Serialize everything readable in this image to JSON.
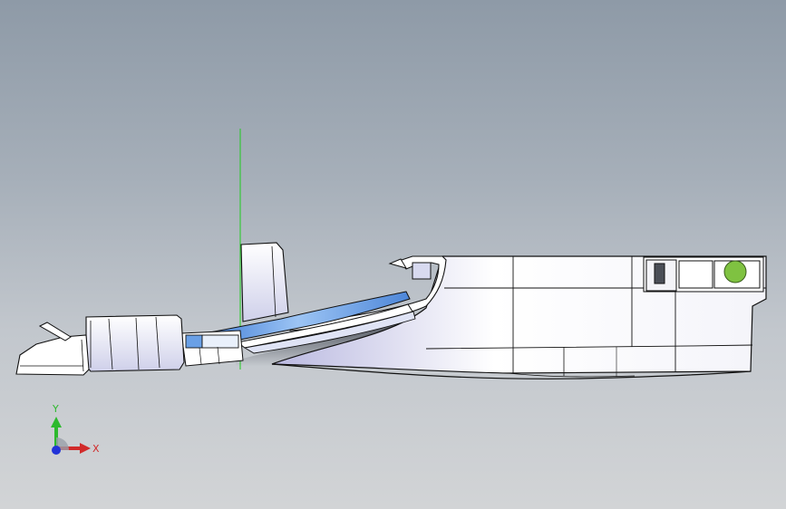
{
  "viewport": {
    "colors": {
      "bg_top": "#8e9aa7",
      "bg_bottom": "#d2d4d6",
      "edge": "#111111",
      "face_light": "#ffffff",
      "face_shade": "#c9cbe6",
      "accent_blue": "#6aa0e6",
      "status_green": "#7fc241",
      "axis_green": "#1fcc1f"
    }
  },
  "triad": {
    "x_label": "X",
    "y_label": "Y",
    "icons": [
      "x-axis-arrow-icon",
      "y-axis-arrow-icon",
      "z-axis-dot-icon"
    ]
  }
}
